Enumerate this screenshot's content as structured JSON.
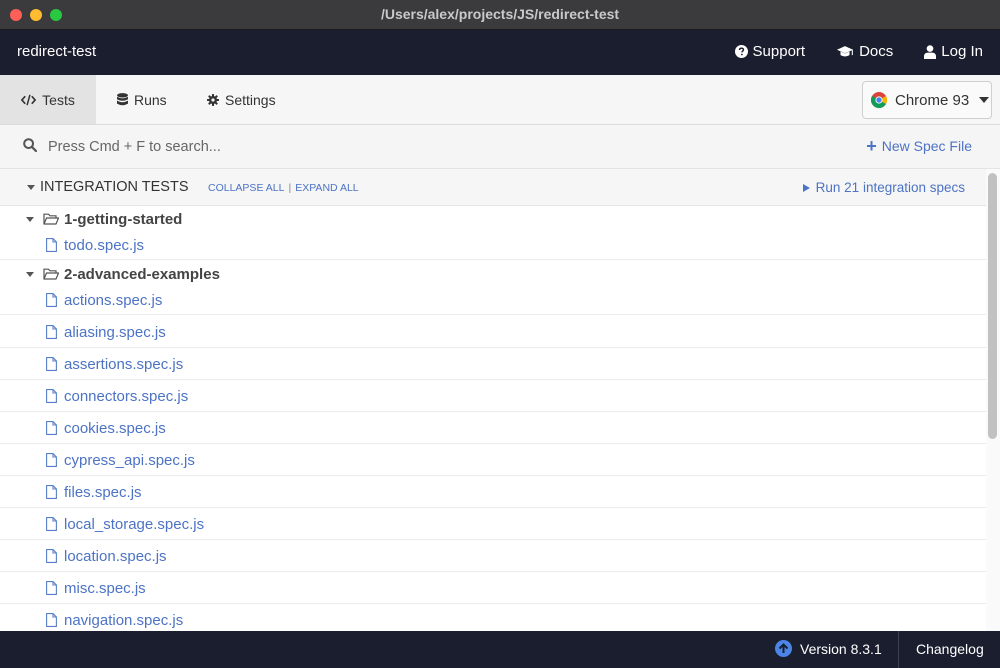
{
  "window": {
    "title": "/Users/alex/projects/JS/redirect-test"
  },
  "header": {
    "project_name": "redirect-test",
    "links": {
      "support": "Support",
      "docs": "Docs",
      "login": "Log In"
    }
  },
  "nav": {
    "tabs": {
      "tests": "Tests",
      "runs": "Runs",
      "settings": "Settings"
    },
    "active_tab": "Tests",
    "browser": "Chrome 93"
  },
  "search": {
    "placeholder": "Press Cmd + F to search...",
    "value": "",
    "new_spec_label": "New Spec File"
  },
  "integration": {
    "title": "INTEGRATION TESTS",
    "collapse_all": "COLLAPSE ALL",
    "separator": "|",
    "expand_all": "EXPAND ALL",
    "run_label": "Run 21 integration specs"
  },
  "folders": [
    {
      "name": "1-getting-started",
      "files": [
        "todo.spec.js"
      ]
    },
    {
      "name": "2-advanced-examples",
      "files": [
        "actions.spec.js",
        "aliasing.spec.js",
        "assertions.spec.js",
        "connectors.spec.js",
        "cookies.spec.js",
        "cypress_api.spec.js",
        "files.spec.js",
        "local_storage.spec.js",
        "location.spec.js",
        "misc.spec.js",
        "navigation.spec.js"
      ]
    }
  ],
  "footer": {
    "version": "Version 8.3.1",
    "changelog": "Changelog"
  },
  "colors": {
    "accent": "#4c73c4",
    "header_bg": "#1b1e2e",
    "update_icon": "#4b85e8"
  },
  "icons": {
    "support": "question-circle-icon",
    "docs": "graduation-cap-icon",
    "login": "user-icon",
    "tests": "code-icon",
    "runs": "database-icon",
    "settings": "gear-icon",
    "browser": "chrome-icon",
    "search": "search-icon",
    "folder": "folder-open-icon",
    "file": "file-icon",
    "version": "arrow-up-circle-icon"
  }
}
